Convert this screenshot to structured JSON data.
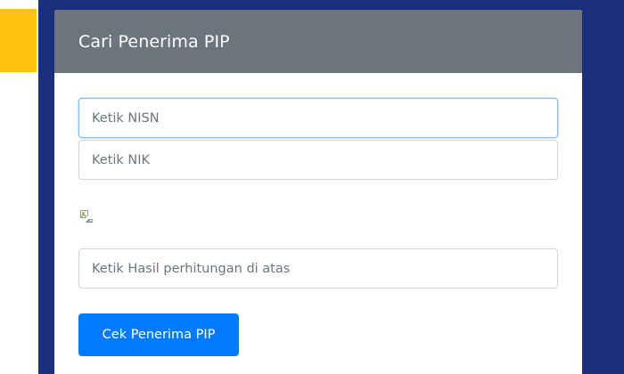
{
  "search_card": {
    "title": "Cari Penerima PIP",
    "nisn_placeholder": "Ketik NISN",
    "nik_placeholder": "Ketik NIK",
    "captcha_image": "broken-image-icon",
    "captcha_answer_placeholder": "Ketik Hasil perhitungan di atas",
    "submit_label": "Cek Penerima PIP"
  },
  "colors": {
    "page_background": "#1b2f7e",
    "left_accent": "#ffc20e",
    "card_header": "#6c757d",
    "primary_button": "#007bff",
    "focus_border": "#80bdff"
  }
}
